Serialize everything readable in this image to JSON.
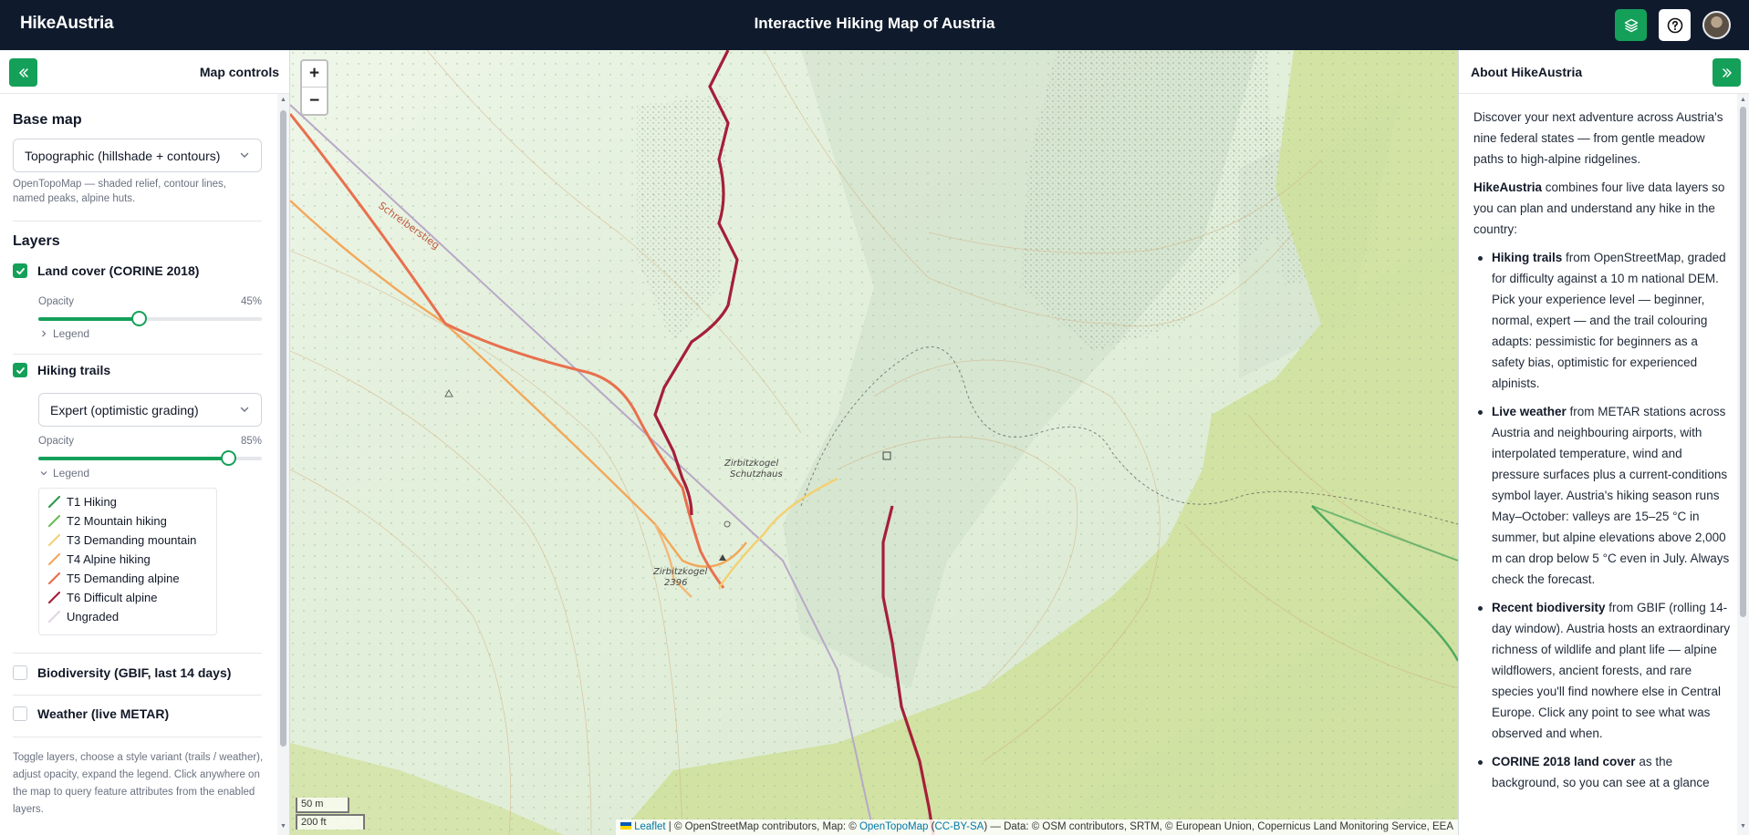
{
  "header": {
    "brand": "HikeAustria",
    "title": "Interactive Hiking Map of Austria",
    "layers_icon": "layers-icon",
    "help_icon": "help-icon"
  },
  "left_panel": {
    "title": "Map controls",
    "base_map": {
      "heading": "Base map",
      "selected": "Topographic (hillshade + contours)",
      "description": "OpenTopoMap — shaded relief, contour lines, named peaks, alpine huts."
    },
    "layers": {
      "heading": "Layers",
      "land_cover": {
        "label": "Land cover (CORINE 2018)",
        "checked": true,
        "opacity_label": "Opacity",
        "opacity_value": "45%",
        "opacity_fraction": 0.45,
        "legend_label": "Legend"
      },
      "hiking_trails": {
        "label": "Hiking trails",
        "checked": true,
        "variant": "Expert (optimistic grading)",
        "opacity_label": "Opacity",
        "opacity_value": "85%",
        "opacity_fraction": 0.85,
        "legend_label": "Legend",
        "legend": [
          {
            "label": "T1 Hiking",
            "color": "#2e9b4e"
          },
          {
            "label": "T2 Mountain hiking",
            "color": "#6dbf58"
          },
          {
            "label": "T3 Demanding mountain",
            "color": "#f3d173"
          },
          {
            "label": "T4 Alpine hiking",
            "color": "#f2a85a"
          },
          {
            "label": "T5 Demanding alpine",
            "color": "#e8704e"
          },
          {
            "label": "T6 Difficult alpine",
            "color": "#a51f3a"
          },
          {
            "label": "Ungraded",
            "color": "#e0d6e4"
          }
        ]
      },
      "biodiversity": {
        "label": "Biodiversity (GBIF, last 14 days)",
        "checked": false
      },
      "weather": {
        "label": "Weather (live METAR)",
        "checked": false
      }
    },
    "footer": "Toggle layers, choose a style variant (trails / weather), adjust opacity, expand the legend. Click anywhere on the map to query feature attributes from the enabled layers."
  },
  "map": {
    "zoom_in": "+",
    "zoom_out": "−",
    "scale_metric": "50 m",
    "scale_imperial": "200 ft",
    "trail_label": "Schreiberstieg",
    "hut_label_1": "Zirbitzkogel",
    "hut_label_2": "Schutzhaus",
    "peak_label_1": "Zirbitzkogel",
    "peak_label_2": "2396",
    "attribution": {
      "leaflet": "Leaflet",
      "part1": " | © OpenStreetMap contributors, Map: © ",
      "opentopomap": "OpenTopoMap",
      "part2": " (",
      "ccbysa": "CC-BY-SA",
      "part3": ") — Data: © OSM contributors, SRTM, © European Union, Copernicus Land Monitoring Service, EEA"
    }
  },
  "right_panel": {
    "title": "About HikeAustria",
    "intro": "Discover your next adventure across Austria's nine federal states — from gentle meadow paths to high-alpine ridgelines.",
    "p2_bold": "HikeAustria",
    "p2_rest": " combines four live data layers so you can plan and understand any hike in the country:",
    "items": [
      {
        "bold": "Hiking trails",
        "rest": " from OpenStreetMap, graded for difficulty against a 10 m national DEM. Pick your experience level — beginner, normal, expert — and the trail colouring adapts: pessimistic for beginners as a safety bias, optimistic for experienced alpinists."
      },
      {
        "bold": "Live weather",
        "rest": " from METAR stations across Austria and neighbouring airports, with interpolated temperature, wind and pressure surfaces plus a current-conditions symbol layer. Austria's hiking season runs May–October: valleys are 15–25 °C in summer, but alpine elevations above 2,000 m can drop below 5 °C even in July. Always check the forecast."
      },
      {
        "bold": "Recent biodiversity",
        "rest": " from GBIF (rolling 14-day window). Austria hosts an extraordinary richness of wildlife and plant life — alpine wildflowers, ancient forests, and rare species you'll find nowhere else in Central Europe. Click any point to see what was observed and when."
      },
      {
        "bold": "CORINE 2018 land cover",
        "rest": " as the background, so you can see at a glance"
      }
    ]
  }
}
